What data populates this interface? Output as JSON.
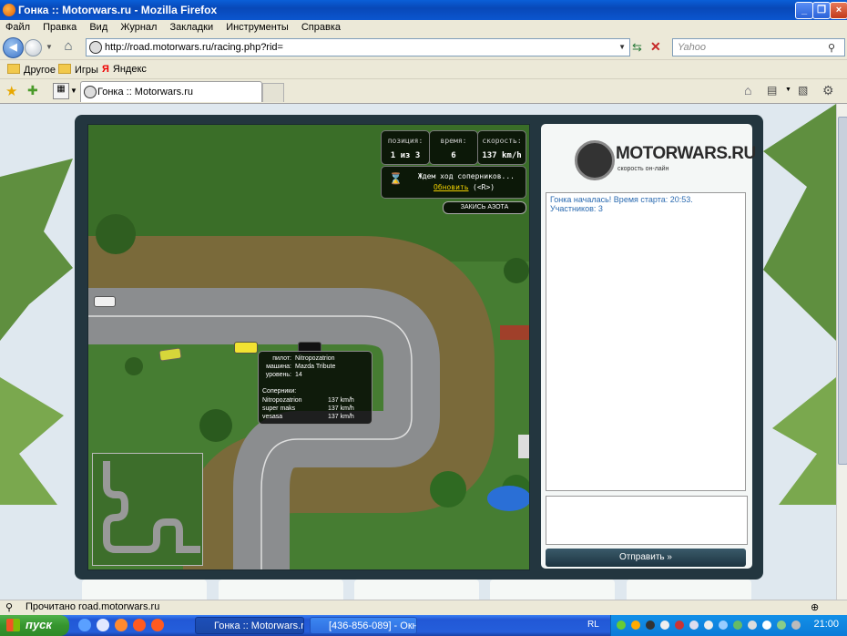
{
  "window": {
    "title": "Гонка :: Motorwars.ru - Mozilla Firefox"
  },
  "menu": [
    "Файл",
    "Правка",
    "Вид",
    "Журнал",
    "Закладки",
    "Инструменты",
    "Справка"
  ],
  "nav": {
    "url": "http://road.motorwars.ru/racing.php?rid=",
    "search_placeholder": "Yahoo"
  },
  "bookmarks": [
    "Другое",
    "Игры",
    "Яндекс"
  ],
  "tabs": [
    {
      "label": "Гонка :: Motorwars.ru"
    }
  ],
  "hud": {
    "position_label": "позиция:",
    "position_value": "1 из 3",
    "time_label": "время:",
    "time_value": "6",
    "speed_label": "скорость:",
    "speed_value": "137 km/h",
    "waiting_text": "Ждем ход соперников...",
    "refresh_link": "Обновить",
    "refresh_hotkey": "(<R>)",
    "nitro_button": "ЗАКИСЬ АЗОТА"
  },
  "car_info": {
    "pilot_label": "пилот:",
    "pilot_value": "Nitropozatrion",
    "car_label": "машина:",
    "car_value": "Mazda Tribute",
    "level_label": "уровень:",
    "level_value": "14",
    "rivals_label": "Соперники:",
    "rivals": [
      {
        "name": "Nitropozatrion",
        "speed": "137 km/h"
      },
      {
        "name": "super maks",
        "speed": "137 km/h"
      },
      {
        "name": "vesasa",
        "speed": "137 km/h"
      }
    ]
  },
  "chat": {
    "logo_text": "MOTORWARS.RU",
    "logo_tagline": "скорость он-лайн",
    "log_lines": [
      "Гонка началась! Время старта: 20:53.",
      "Участников: 3"
    ],
    "send_button": "Отправить »"
  },
  "status": {
    "text": "Прочитано road.motorwars.ru"
  },
  "taskbar": {
    "start": "пуск",
    "tasks": [
      "Гонка :: Motorwars.r...",
      "[436-856-089] - Окн..."
    ],
    "lang": "RL",
    "clock": "21:00"
  }
}
